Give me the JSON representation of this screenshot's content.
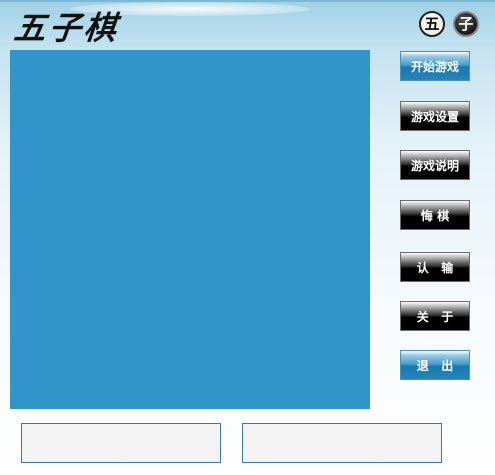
{
  "header": {
    "logo_text": "五子棋",
    "badge_white": "五",
    "badge_black": "子"
  },
  "menu": {
    "start": "开始游戏",
    "settings": "游戏设置",
    "help": "游戏说明",
    "undo": "悔 棋",
    "resign": "认   输",
    "about": "关   于",
    "exit": "退   出"
  },
  "colors": {
    "board": "#3195c9",
    "dark_button": "#000000",
    "blue_button": "#2484bb"
  }
}
